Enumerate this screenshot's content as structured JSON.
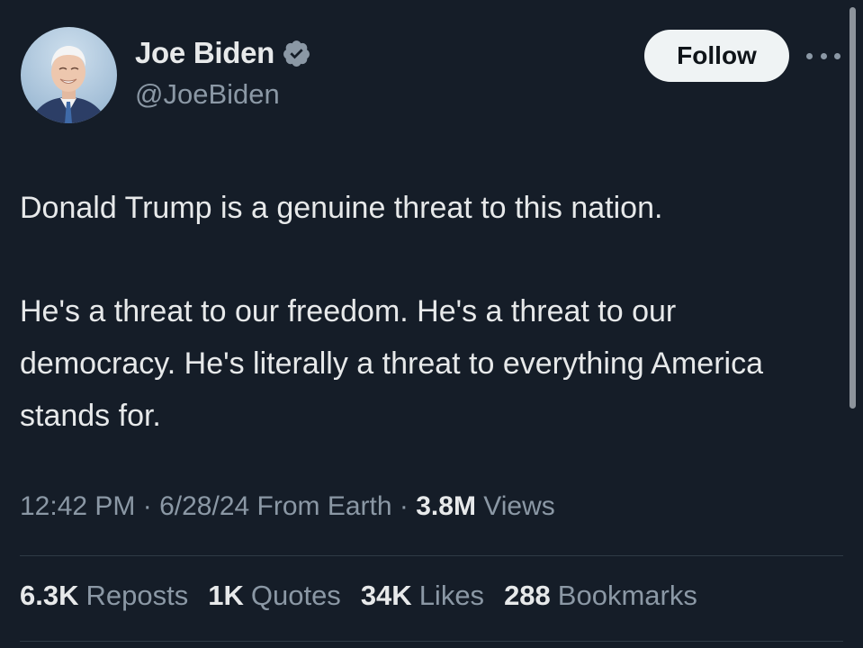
{
  "author": {
    "display_name": "Joe Biden",
    "handle": "@JoeBiden",
    "verified_icon": "verified-badge-icon",
    "avatar": "profile-photo"
  },
  "header": {
    "follow_label": "Follow",
    "more_icon": "more-options-icon"
  },
  "tweet": {
    "paragraph_1": "Donald Trump is a genuine threat to this nation.",
    "paragraph_2": "He's a threat to our freedom. He's a threat to our democracy. He's literally a threat to everything America stands for."
  },
  "meta": {
    "time": "12:42 PM",
    "date": "6/28/24",
    "source": "From Earth",
    "views_count": "3.8M",
    "views_label": "Views"
  },
  "stats": [
    {
      "count": "6.3K",
      "label": "Reposts"
    },
    {
      "count": "1K",
      "label": "Quotes"
    },
    {
      "count": "34K",
      "label": "Likes"
    },
    {
      "count": "288",
      "label": "Bookmarks"
    }
  ],
  "colors": {
    "background": "#151d28",
    "text_primary": "#e7e9ea",
    "text_secondary": "#8b98a5",
    "follow_bg": "#eff3f4",
    "verified_badge": "#8b98a5"
  }
}
